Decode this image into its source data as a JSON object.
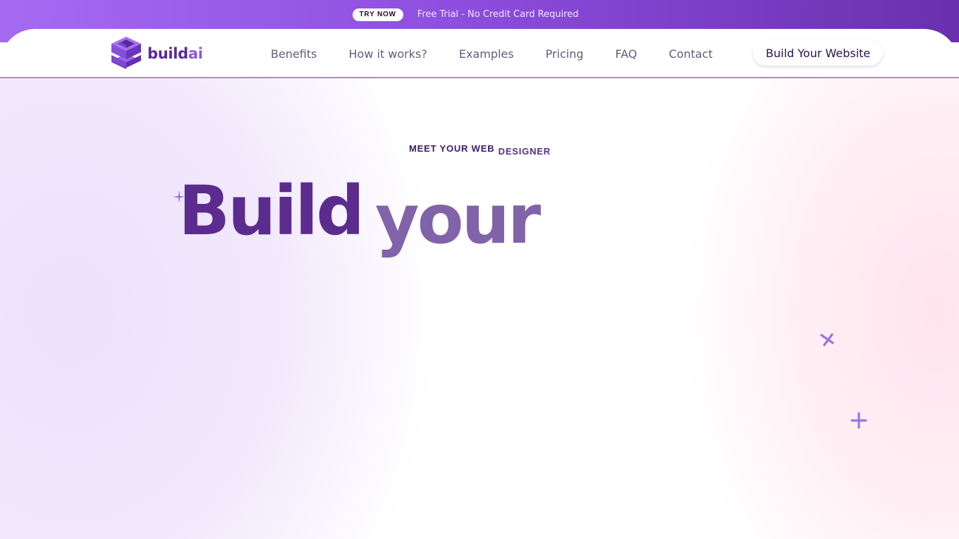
{
  "announcement": {
    "badge_label": "TRY NOW",
    "text": "Free Trial - No Credit Card Required"
  },
  "header": {
    "logo": {
      "icon": "stacked-cube-logo-icon",
      "name_part1": "build",
      "name_part2": "ai"
    },
    "nav_items": [
      {
        "label": "Benefits"
      },
      {
        "label": "How it works?"
      },
      {
        "label": "Examples"
      },
      {
        "label": "Pricing"
      },
      {
        "label": "FAQ"
      },
      {
        "label": "Contact"
      }
    ],
    "cta_label": "Build Your Website"
  },
  "hero": {
    "eyebrow_part1": "MEET YOUR WEB",
    "eyebrow_part2": "DESIGNER",
    "headline_word1": "Build",
    "headline_word2": "your",
    "decorations": [
      "sparkle-plus-icon",
      "sparkle-x-icon",
      "sparkle-plus-icon"
    ]
  },
  "colors": {
    "brand_primary": "#5b2c8e",
    "brand_secondary": "#8a5ad6",
    "announcement_gradient_start": "#a76af2",
    "announcement_gradient_end": "#6a2fae",
    "sparkle": "#9b74e0"
  }
}
